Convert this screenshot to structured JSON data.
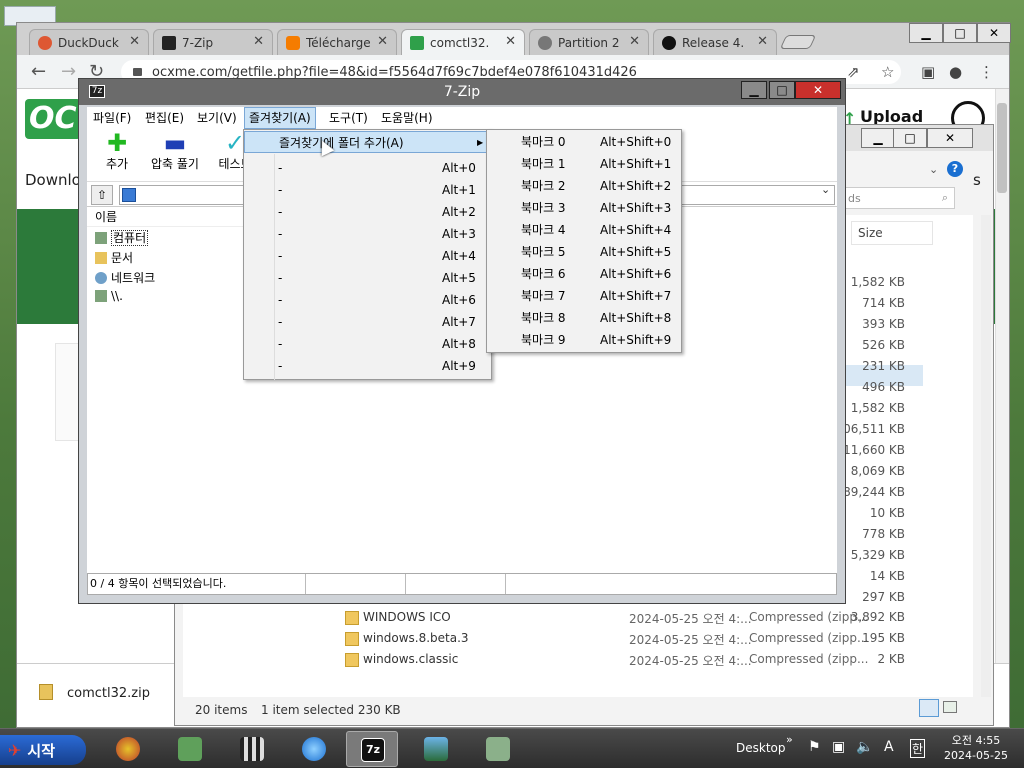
{
  "chrome": {
    "tabs": [
      {
        "title": "DuckDuck",
        "favicon_color": "#de5833"
      },
      {
        "title": "7-Zip",
        "favicon_color": "#222222"
      },
      {
        "title": "Télécharge",
        "favicon_color": "#f57c00"
      },
      {
        "title": "comctl32.",
        "favicon_color": "#2fa04a"
      },
      {
        "title": "Partition 2",
        "favicon_color": "#555555"
      },
      {
        "title": "Release 4.",
        "favicon_color": "#111111"
      }
    ],
    "url": "ocxme.com/getfile.php?file=48&id=f5564d7f69c7bdef4e078f610431d426"
  },
  "page": {
    "logo": "OC",
    "download_label": "Downlo",
    "upload_label": "Upload",
    "download_file": "comctl32.zip"
  },
  "explorer": {
    "search_placeholder": "ds",
    "size_header": "Size",
    "sizes": [
      "1,582 KB",
      "714 KB",
      "393 KB",
      "526 KB",
      "231 KB",
      "496 KB",
      "1,582 KB",
      "106,511 KB",
      "11,660 KB",
      "8,069 KB",
      "89,244 KB",
      "10 KB",
      "778 KB",
      "5,329 KB",
      "14 KB",
      "297 KB"
    ],
    "rows": [
      {
        "name": "WINDOWS ICO",
        "date": "2024-05-25 오전 4:...",
        "type": "Compressed (zipp...",
        "size": "3,892 KB"
      },
      {
        "name": "windows.8.beta.3",
        "date": "2024-05-25 오전 4:...",
        "type": "Compressed (zipp...",
        "size": "195 KB"
      },
      {
        "name": "windows.classic",
        "date": "2024-05-25 오전 4:...",
        "type": "Compressed (zipp...",
        "size": "2 KB"
      }
    ],
    "status_items": "20 items",
    "status_selected": "1 item selected  230 KB"
  },
  "zip": {
    "title": "7-Zip",
    "icon_label": "7z",
    "menus": [
      "파일(F)",
      "편집(E)",
      "보기(V)",
      "즐겨찾기(A)",
      "도구(T)",
      "도움말(H)"
    ],
    "toolbar": {
      "add": "추가",
      "extract": "압축 풀기",
      "test": "테스트"
    },
    "column_name": "이름",
    "tree": [
      "컴퓨터",
      "문서",
      "네트워크",
      "\\\\."
    ],
    "status": "0 / 4 항목이 선택되었습니다."
  },
  "fav_menu": {
    "add_label": "즐겨찾기에 폴더 추가(A)",
    "items": [
      {
        "label": "-",
        "key": "Alt+0"
      },
      {
        "label": "-",
        "key": "Alt+1"
      },
      {
        "label": "-",
        "key": "Alt+2"
      },
      {
        "label": "-",
        "key": "Alt+3"
      },
      {
        "label": "-",
        "key": "Alt+4"
      },
      {
        "label": "-",
        "key": "Alt+5"
      },
      {
        "label": "-",
        "key": "Alt+6"
      },
      {
        "label": "-",
        "key": "Alt+7"
      },
      {
        "label": "-",
        "key": "Alt+8"
      },
      {
        "label": "-",
        "key": "Alt+9"
      }
    ]
  },
  "bookmark_menu": {
    "items": [
      {
        "label": "북마크 0",
        "key": "Alt+Shift+0"
      },
      {
        "label": "북마크 1",
        "key": "Alt+Shift+1"
      },
      {
        "label": "북마크 2",
        "key": "Alt+Shift+2"
      },
      {
        "label": "북마크 3",
        "key": "Alt+Shift+3"
      },
      {
        "label": "북마크 4",
        "key": "Alt+Shift+4"
      },
      {
        "label": "북마크 5",
        "key": "Alt+Shift+5"
      },
      {
        "label": "북마크 6",
        "key": "Alt+Shift+6"
      },
      {
        "label": "북마크 7",
        "key": "Alt+Shift+7"
      },
      {
        "label": "북마크 8",
        "key": "Alt+Shift+8"
      },
      {
        "label": "북마크 9",
        "key": "Alt+Shift+9"
      }
    ]
  },
  "taskbar": {
    "start_label": "시작",
    "desktop_label": "Desktop",
    "ime_label": "A",
    "ime_lang": "한",
    "time": "오전 4:55",
    "date": "2024-05-25"
  }
}
